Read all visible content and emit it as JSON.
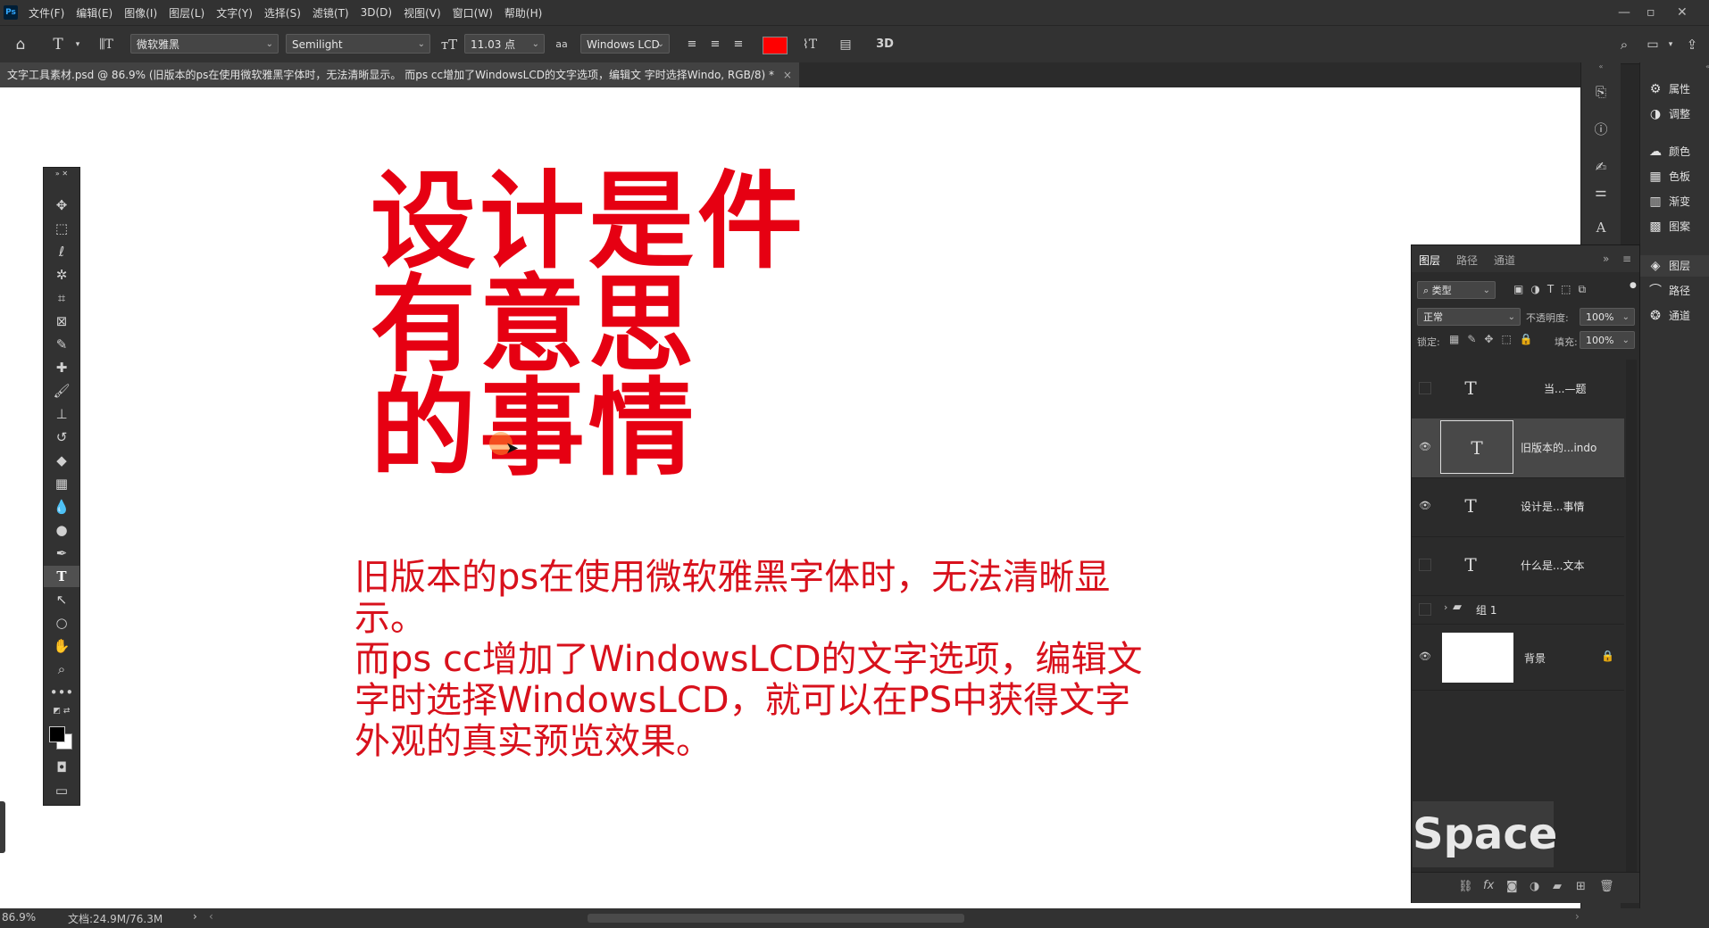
{
  "menu": {
    "items": [
      "文件(F)",
      "编辑(E)",
      "图像(I)",
      "图层(L)",
      "文字(Y)",
      "选择(S)",
      "滤镜(T)",
      "3D(D)",
      "视图(V)",
      "窗口(W)",
      "帮助(H)"
    ],
    "logo": "Ps"
  },
  "options": {
    "font_family": "微软雅黑",
    "font_style": "Semilight",
    "font_size": "11.03 点",
    "antialias_label": "aa",
    "antialias_value": "Windows LCD",
    "text_color": "#ff0000",
    "label_3d": "3D"
  },
  "document": {
    "tab_title": "文字工具素材.psd @ 86.9% (旧版本的ps在使用微软雅黑字体时，无法清晰显示。 而ps cc增加了WindowsLCD的文字选项，编辑文 字时选择Windo, RGB/8) *",
    "tab_close": "×"
  },
  "canvas": {
    "headline_lines": [
      "设计是件",
      "有意思",
      "的事情"
    ],
    "body_lines": [
      "旧版本的ps在使用微软雅黑字体时，无法清晰显示。",
      "而ps cc增加了WindowsLCD的文字选项，编辑文",
      "字时选择WindowsLCD，就可以在PS中获得文字",
      "外观的真实预览效果。"
    ],
    "headline_color": "#e60012",
    "body_color": "#d8111c"
  },
  "right_list": {
    "properties": "属性",
    "adjustments": "调整",
    "color": "颜色",
    "swatches": "色板",
    "gradients": "渐变",
    "patterns": "图案",
    "layers": "图层",
    "paths": "路径",
    "channels": "通道"
  },
  "layers_panel": {
    "tab_layers": "图层",
    "tab_paths": "路径",
    "tab_channels": "通道",
    "filter_kind": "类型",
    "blend_mode": "正常",
    "opacity_label": "不透明度:",
    "opacity_value": "100%",
    "lock_label": "锁定:",
    "fill_label": "填充:",
    "fill_value": "100%",
    "rows": [
      {
        "name": "当...—题",
        "visible": false,
        "type": "text"
      },
      {
        "name": "旧版本的...indo",
        "visible": true,
        "type": "text",
        "selected": true
      },
      {
        "name": "设计是...事情",
        "visible": true,
        "type": "text"
      },
      {
        "name": "什么是...文本",
        "visible": false,
        "type": "text"
      },
      {
        "name": "组 1",
        "visible": false,
        "type": "group"
      },
      {
        "name": "背景",
        "visible": true,
        "type": "background"
      }
    ]
  },
  "overlay": {
    "key_badge": "Space"
  },
  "status": {
    "zoom": "86.9%",
    "doc_size": "文档:24.9M/76.3M",
    "arrow": "›"
  }
}
